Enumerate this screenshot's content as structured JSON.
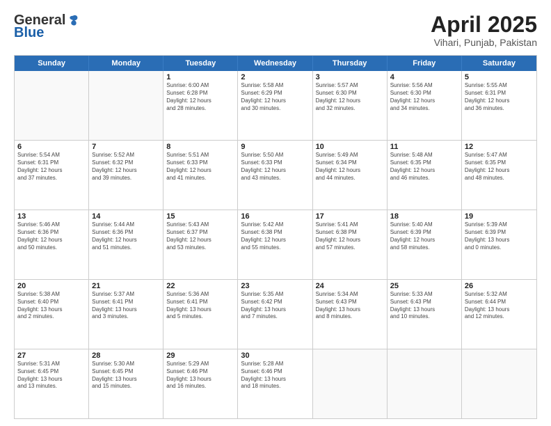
{
  "logo": {
    "general": "General",
    "blue": "Blue"
  },
  "title": "April 2025",
  "subtitle": "Vihari, Punjab, Pakistan",
  "headers": [
    "Sunday",
    "Monday",
    "Tuesday",
    "Wednesday",
    "Thursday",
    "Friday",
    "Saturday"
  ],
  "weeks": [
    [
      {
        "day": "",
        "info": ""
      },
      {
        "day": "",
        "info": ""
      },
      {
        "day": "1",
        "info": "Sunrise: 6:00 AM\nSunset: 6:28 PM\nDaylight: 12 hours\nand 28 minutes."
      },
      {
        "day": "2",
        "info": "Sunrise: 5:58 AM\nSunset: 6:29 PM\nDaylight: 12 hours\nand 30 minutes."
      },
      {
        "day": "3",
        "info": "Sunrise: 5:57 AM\nSunset: 6:30 PM\nDaylight: 12 hours\nand 32 minutes."
      },
      {
        "day": "4",
        "info": "Sunrise: 5:56 AM\nSunset: 6:30 PM\nDaylight: 12 hours\nand 34 minutes."
      },
      {
        "day": "5",
        "info": "Sunrise: 5:55 AM\nSunset: 6:31 PM\nDaylight: 12 hours\nand 36 minutes."
      }
    ],
    [
      {
        "day": "6",
        "info": "Sunrise: 5:54 AM\nSunset: 6:31 PM\nDaylight: 12 hours\nand 37 minutes."
      },
      {
        "day": "7",
        "info": "Sunrise: 5:52 AM\nSunset: 6:32 PM\nDaylight: 12 hours\nand 39 minutes."
      },
      {
        "day": "8",
        "info": "Sunrise: 5:51 AM\nSunset: 6:33 PM\nDaylight: 12 hours\nand 41 minutes."
      },
      {
        "day": "9",
        "info": "Sunrise: 5:50 AM\nSunset: 6:33 PM\nDaylight: 12 hours\nand 43 minutes."
      },
      {
        "day": "10",
        "info": "Sunrise: 5:49 AM\nSunset: 6:34 PM\nDaylight: 12 hours\nand 44 minutes."
      },
      {
        "day": "11",
        "info": "Sunrise: 5:48 AM\nSunset: 6:35 PM\nDaylight: 12 hours\nand 46 minutes."
      },
      {
        "day": "12",
        "info": "Sunrise: 5:47 AM\nSunset: 6:35 PM\nDaylight: 12 hours\nand 48 minutes."
      }
    ],
    [
      {
        "day": "13",
        "info": "Sunrise: 5:46 AM\nSunset: 6:36 PM\nDaylight: 12 hours\nand 50 minutes."
      },
      {
        "day": "14",
        "info": "Sunrise: 5:44 AM\nSunset: 6:36 PM\nDaylight: 12 hours\nand 51 minutes."
      },
      {
        "day": "15",
        "info": "Sunrise: 5:43 AM\nSunset: 6:37 PM\nDaylight: 12 hours\nand 53 minutes."
      },
      {
        "day": "16",
        "info": "Sunrise: 5:42 AM\nSunset: 6:38 PM\nDaylight: 12 hours\nand 55 minutes."
      },
      {
        "day": "17",
        "info": "Sunrise: 5:41 AM\nSunset: 6:38 PM\nDaylight: 12 hours\nand 57 minutes."
      },
      {
        "day": "18",
        "info": "Sunrise: 5:40 AM\nSunset: 6:39 PM\nDaylight: 12 hours\nand 58 minutes."
      },
      {
        "day": "19",
        "info": "Sunrise: 5:39 AM\nSunset: 6:39 PM\nDaylight: 13 hours\nand 0 minutes."
      }
    ],
    [
      {
        "day": "20",
        "info": "Sunrise: 5:38 AM\nSunset: 6:40 PM\nDaylight: 13 hours\nand 2 minutes."
      },
      {
        "day": "21",
        "info": "Sunrise: 5:37 AM\nSunset: 6:41 PM\nDaylight: 13 hours\nand 3 minutes."
      },
      {
        "day": "22",
        "info": "Sunrise: 5:36 AM\nSunset: 6:41 PM\nDaylight: 13 hours\nand 5 minutes."
      },
      {
        "day": "23",
        "info": "Sunrise: 5:35 AM\nSunset: 6:42 PM\nDaylight: 13 hours\nand 7 minutes."
      },
      {
        "day": "24",
        "info": "Sunrise: 5:34 AM\nSunset: 6:43 PM\nDaylight: 13 hours\nand 8 minutes."
      },
      {
        "day": "25",
        "info": "Sunrise: 5:33 AM\nSunset: 6:43 PM\nDaylight: 13 hours\nand 10 minutes."
      },
      {
        "day": "26",
        "info": "Sunrise: 5:32 AM\nSunset: 6:44 PM\nDaylight: 13 hours\nand 12 minutes."
      }
    ],
    [
      {
        "day": "27",
        "info": "Sunrise: 5:31 AM\nSunset: 6:45 PM\nDaylight: 13 hours\nand 13 minutes."
      },
      {
        "day": "28",
        "info": "Sunrise: 5:30 AM\nSunset: 6:45 PM\nDaylight: 13 hours\nand 15 minutes."
      },
      {
        "day": "29",
        "info": "Sunrise: 5:29 AM\nSunset: 6:46 PM\nDaylight: 13 hours\nand 16 minutes."
      },
      {
        "day": "30",
        "info": "Sunrise: 5:28 AM\nSunset: 6:46 PM\nDaylight: 13 hours\nand 18 minutes."
      },
      {
        "day": "",
        "info": ""
      },
      {
        "day": "",
        "info": ""
      },
      {
        "day": "",
        "info": ""
      }
    ]
  ]
}
